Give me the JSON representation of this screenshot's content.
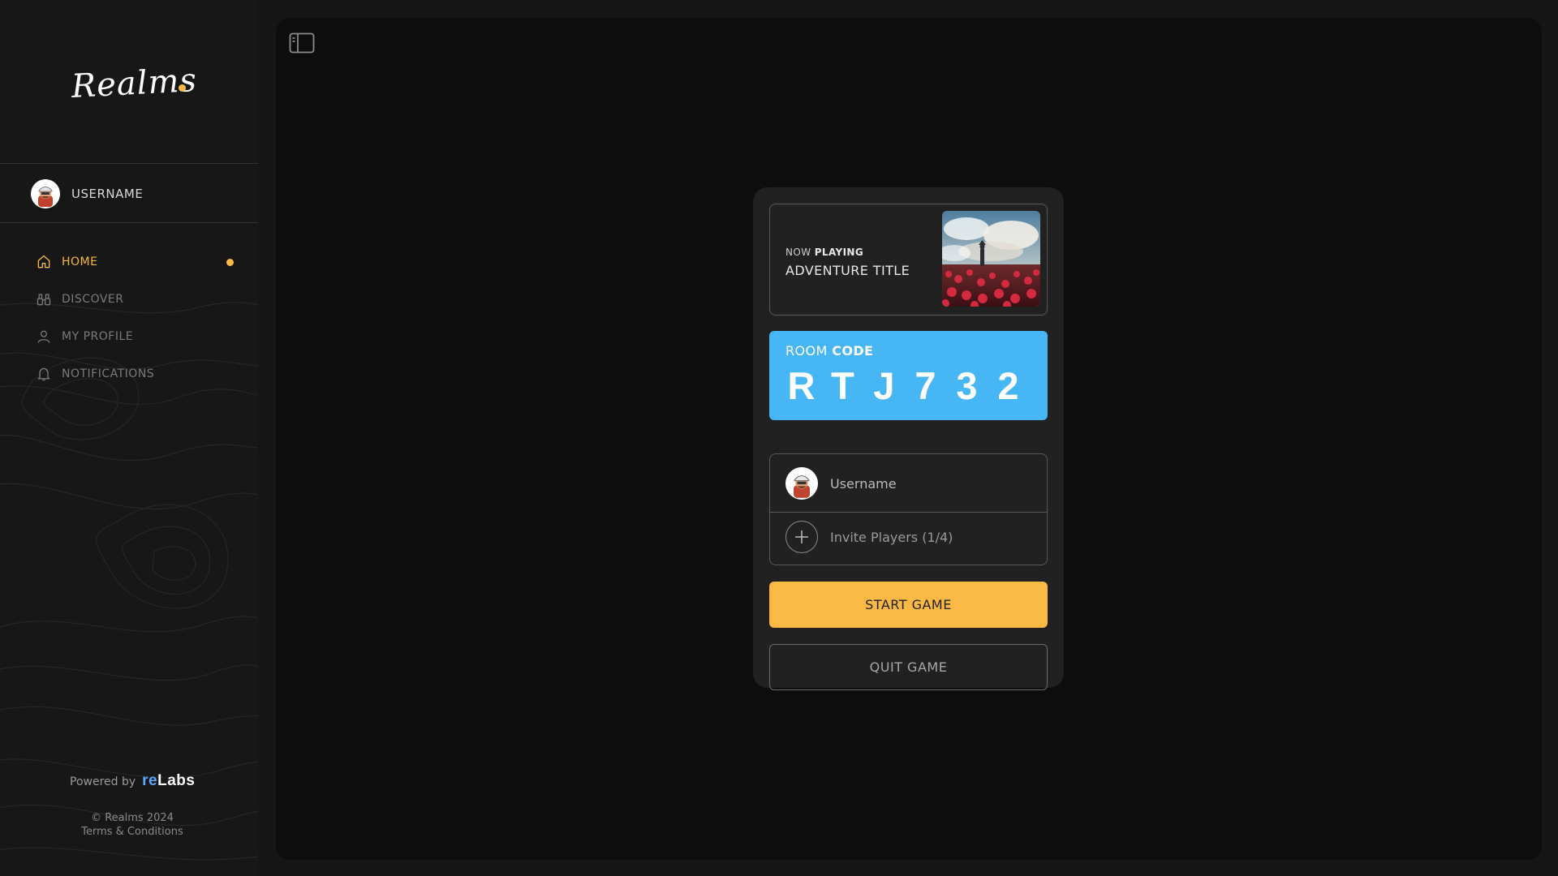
{
  "sidebar": {
    "logo_text": "Realms",
    "user": {
      "name": "USERNAME",
      "avatar_icon": "avatar-icon"
    },
    "nav": [
      {
        "label": "HOME",
        "icon": "home-icon",
        "active": true
      },
      {
        "label": "DISCOVER",
        "icon": "binoculars-icon",
        "active": false
      },
      {
        "label": "MY PROFILE",
        "icon": "user-icon",
        "active": false
      },
      {
        "label": "NOTIFICATIONS",
        "icon": "bell-icon",
        "active": false
      }
    ],
    "powered_by": "Powered by",
    "brand_re": "re",
    "brand_labs": "Labs",
    "copyright": "© Realms 2024",
    "terms": "Terms & Conditions"
  },
  "main": {
    "panel_toggle_icon": "sidebar-toggle-icon"
  },
  "card": {
    "now_playing": {
      "label_now": "NOW ",
      "label_playing": "PLAYING",
      "title": "ADVENTURE TITLE",
      "image": "adventure-thumbnail"
    },
    "room_code": {
      "label_room": "ROOM ",
      "label_code": "CODE",
      "chars": [
        "R",
        "T",
        "J",
        "7",
        "3",
        "2"
      ]
    },
    "players": {
      "player_name": "Username",
      "invite_label": "Invite Players (1/4)"
    },
    "start_label": "START GAME",
    "quit_label": "QUIT GAME"
  },
  "colors": {
    "accent": "#f9b944",
    "room_code_bg": "#47b6f5",
    "background": "#151515",
    "panel": "#0d0d0d",
    "card": "#212121"
  }
}
